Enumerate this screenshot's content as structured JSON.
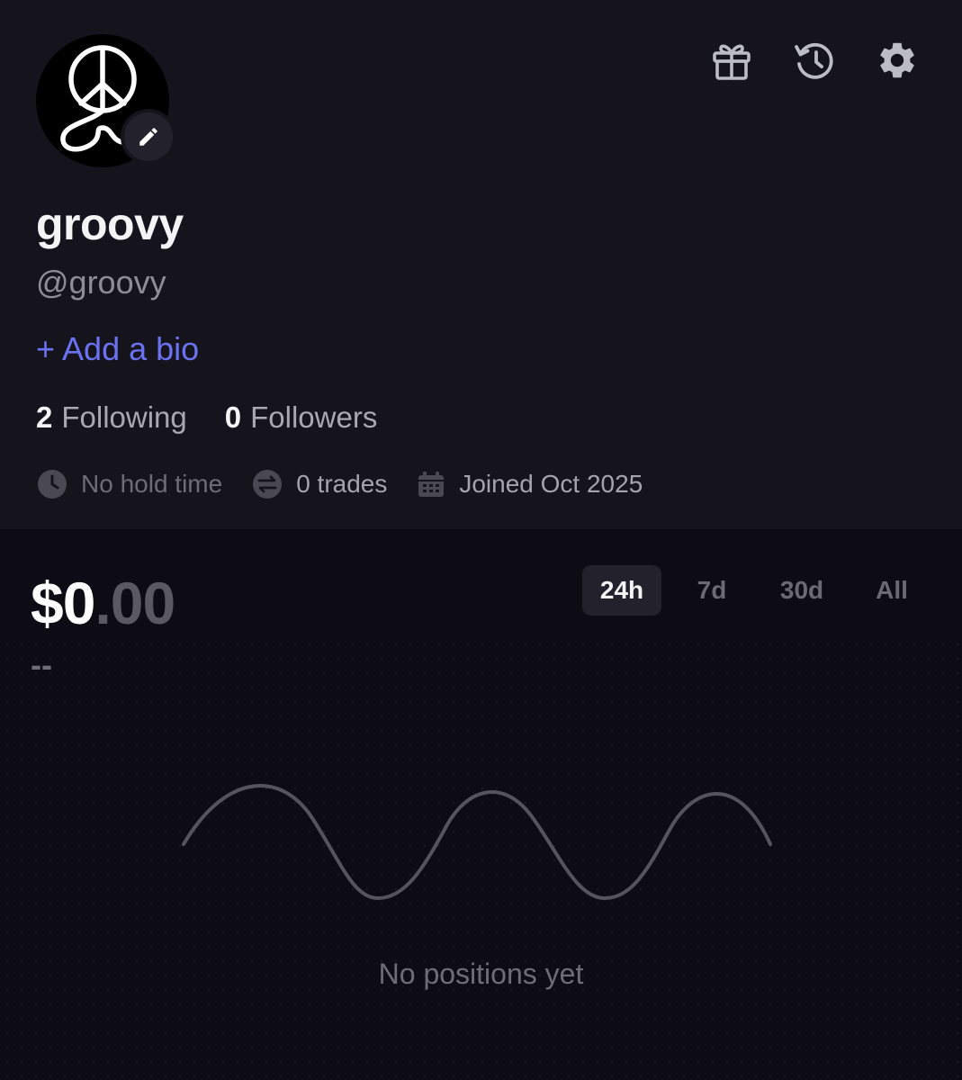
{
  "profile": {
    "display_name": "groovy",
    "handle": "@groovy",
    "add_bio_label": "+ Add a bio",
    "following_count": "2",
    "following_label": "Following",
    "followers_count": "0",
    "followers_label": "Followers",
    "hold_time": "No hold time",
    "trades": "0 trades",
    "joined": "Joined Oct 2025"
  },
  "header_icons": [
    "gift-icon",
    "history-icon",
    "gear-icon"
  ],
  "portfolio": {
    "balance_int": "$0",
    "balance_dec": ".00",
    "change": "--",
    "range_tabs": [
      {
        "label": "24h",
        "active": true
      },
      {
        "label": "7d",
        "active": false
      },
      {
        "label": "30d",
        "active": false
      },
      {
        "label": "All",
        "active": false
      }
    ],
    "empty_text": "No positions yet"
  },
  "colors": {
    "accent": "#6b72f2",
    "header_bg": "#15141d",
    "body_bg": "#0d0c14"
  }
}
